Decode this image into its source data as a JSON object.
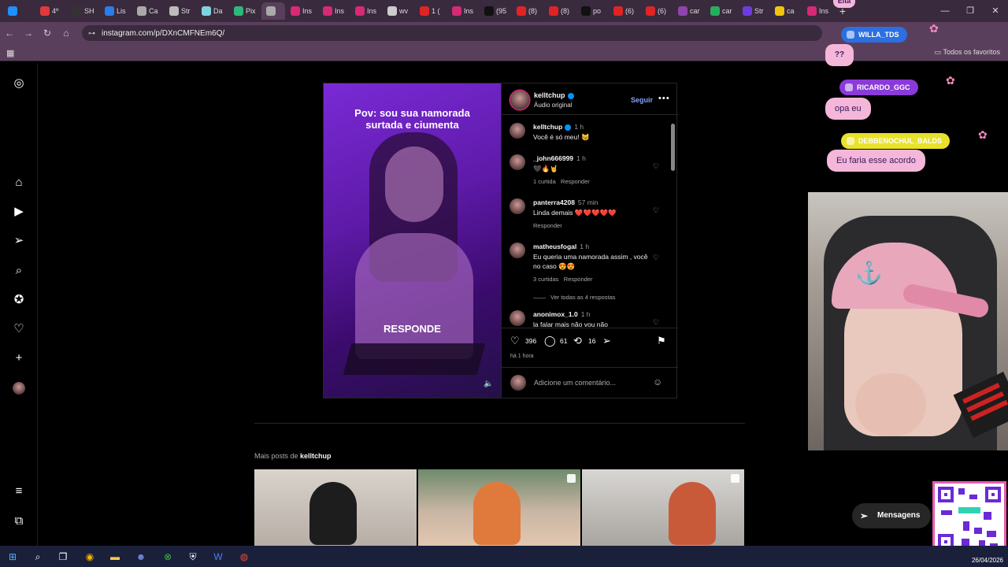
{
  "browser": {
    "tabs": [
      {
        "label": "",
        "color": "#1e90ff"
      },
      {
        "label": "4º",
        "color": "#e03a3a"
      },
      {
        "label": "SH",
        "color": "#333333"
      },
      {
        "label": "Lis",
        "color": "#2b7de9"
      },
      {
        "label": "Ca",
        "color": "#aaaaaa"
      },
      {
        "label": "Str",
        "color": "#bbbbbb"
      },
      {
        "label": "Da",
        "color": "#7fd3e0"
      },
      {
        "label": "Pix",
        "color": "#2fb87a"
      },
      {
        "label": "",
        "color": "#aaaaaa",
        "active": true
      },
      {
        "label": "Ins",
        "color": "#d62976"
      },
      {
        "label": "Ins",
        "color": "#d62976"
      },
      {
        "label": "Ins",
        "color": "#d62976"
      },
      {
        "label": "wv",
        "color": "#cccccc"
      },
      {
        "label": "1 (",
        "color": "#e02424"
      },
      {
        "label": "Ins",
        "color": "#d62976"
      },
      {
        "label": "(95",
        "color": "#111111"
      },
      {
        "label": "(8)",
        "color": "#e02424"
      },
      {
        "label": "(8)",
        "color": "#e02424"
      },
      {
        "label": "po",
        "color": "#111111"
      },
      {
        "label": "(6)",
        "color": "#e02424"
      },
      {
        "label": "(6)",
        "color": "#e02424"
      },
      {
        "label": "car",
        "color": "#8e44ad"
      },
      {
        "label": "car",
        "color": "#27ae60"
      },
      {
        "label": "Str",
        "color": "#6c3ce0"
      },
      {
        "label": "ca",
        "color": "#f1c40f"
      },
      {
        "label": "Ins",
        "color": "#d62976"
      }
    ],
    "url": "instagram.com/p/DXnCMFNEm6Q/",
    "bookmarks_all": "Todos os favoritos"
  },
  "post": {
    "caption_top": "Pov: sou sua namorada surtada e ciumenta",
    "caption_bottom": "RESPONDE",
    "author": "kelltchup",
    "audio": "Áudio original",
    "follow_label": "Seguir",
    "caption_comment": {
      "user": "kelltchup",
      "time": "1 h",
      "text": "Você é só meu! 😼"
    },
    "comments": [
      {
        "user": "_john666999",
        "time": "1 h",
        "text": "🖤🔥🤘",
        "likes": "1 curtida",
        "reply": "Responder"
      },
      {
        "user": "panterra4208",
        "time": "57 min",
        "text": "Linda demais ❤️❤️❤️❤️❤️",
        "likes": "",
        "reply": "Responder"
      },
      {
        "user": "matheusfogal",
        "time": "1 h",
        "text": "Eu queria uma namorada assim , você no caso 😍😍",
        "likes": "3 curtidas",
        "reply": "Responder"
      },
      {
        "user": "anonimox_1.0",
        "time": "1 h",
        "text": "la falar mais não vou não",
        "likes": "",
        "reply": ""
      }
    ],
    "view_replies": "Ver todas as 4 respostas",
    "like_count": "396",
    "comment_count": "61",
    "share_count": "16",
    "posted": "há 1 hora",
    "add_comment_placeholder": "Adicione um comentário..."
  },
  "more_posts": {
    "prefix": "Mais posts de",
    "user": "kelltchup"
  },
  "overlay": {
    "top_text": "Eita",
    "chat": [
      {
        "user": "WILLA_TDS",
        "message": "??",
        "color": "#2b6fe0"
      },
      {
        "user": "RICARDO_GGC",
        "message": "opa eu",
        "color": "#8a3ad8"
      },
      {
        "user": "DEBBENOCHUL_BALDS",
        "message": "Eu faria esse acordo",
        "color": "#e8e22a"
      }
    ]
  },
  "messages_label": "Mensagens",
  "taskbar": {
    "date": "26/04/2026"
  }
}
